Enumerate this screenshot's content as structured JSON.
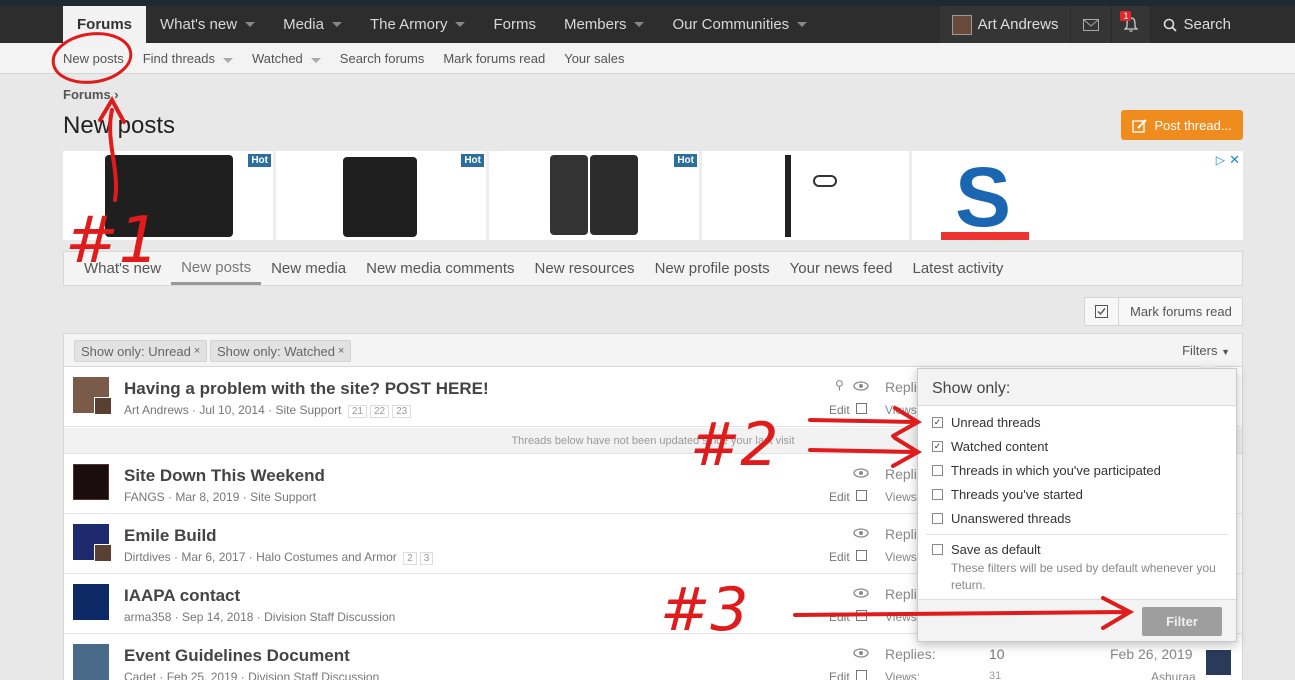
{
  "nav": {
    "items": [
      {
        "label": "Forums",
        "active": true,
        "caret": false
      },
      {
        "label": "What's new",
        "active": false,
        "caret": true
      },
      {
        "label": "Media",
        "active": false,
        "caret": true
      },
      {
        "label": "The Armory",
        "active": false,
        "caret": true
      },
      {
        "label": "Forms",
        "active": false,
        "caret": false
      },
      {
        "label": "Members",
        "active": false,
        "caret": true
      },
      {
        "label": "Our Communities",
        "active": false,
        "caret": true
      }
    ],
    "user_name": "Art Andrews",
    "alerts_count": "1",
    "search_label": "Search"
  },
  "subnav": {
    "new_posts": "New posts",
    "find_threads": "Find threads",
    "watched": "Watched",
    "search_forums": "Search forums",
    "mark_forums_read": "Mark forums read",
    "your_sales": "Your sales"
  },
  "breadcrumb": "Forums",
  "page_title": "New posts",
  "post_thread_label": "Post thread...",
  "ads": {
    "hot_label": "Hot",
    "brand_letter": "S"
  },
  "tabs": [
    {
      "label": "What's new",
      "active": false
    },
    {
      "label": "New posts",
      "active": true
    },
    {
      "label": "New media",
      "active": false
    },
    {
      "label": "New media comments",
      "active": false
    },
    {
      "label": "New resources",
      "active": false
    },
    {
      "label": "New profile posts",
      "active": false
    },
    {
      "label": "Your news feed",
      "active": false
    },
    {
      "label": "Latest activity",
      "active": false
    }
  ],
  "mark_read_label": "Mark forums read",
  "filter_pills": [
    "Show only: Unread",
    "Show only: Watched"
  ],
  "filters_label": "Filters",
  "divider_text": "Threads below have not been updated since your last visit",
  "threads": [
    {
      "title": "Having a problem with the site? POST HERE!",
      "author": "Art Andrews",
      "date": "Jul 10, 2014",
      "forum": "Site Support",
      "pages": [
        "21",
        "22",
        "23"
      ],
      "replies_label": "Replies:",
      "views_label": "Views:",
      "replies": "",
      "views": "",
      "last_date": "",
      "last_user": "",
      "sticky": true
    },
    {
      "title": "Site Down This Weekend",
      "author": "FANGS",
      "date": "Mar 8, 2019",
      "forum": "Site Support",
      "pages": [],
      "replies_label": "Replies:",
      "views_label": "Views:",
      "replies": "",
      "views": "",
      "last_date": "",
      "last_user": "",
      "sticky": false
    },
    {
      "title": "Emile Build",
      "author": "Dirtdives",
      "date": "Mar 6, 2017",
      "forum": "Halo Costumes and Armor",
      "pages": [
        "2",
        "3"
      ],
      "replies_label": "Replies:",
      "views_label": "Views:",
      "replies": "",
      "views": "",
      "last_date": "",
      "last_user": "",
      "sticky": false
    },
    {
      "title": "IAAPA contact",
      "author": "arma358",
      "date": "Sep 14, 2018",
      "forum": "Division Staff Discussion",
      "pages": [],
      "replies_label": "Replies:",
      "views_label": "Views:",
      "replies": "",
      "views": "",
      "last_date": "",
      "last_user": "",
      "sticky": false
    },
    {
      "title": "Event Guidelines Document",
      "author": "Cadet",
      "date": "Feb 25, 2019",
      "forum": "Division Staff Discussion",
      "pages": [],
      "replies_label": "Replies:",
      "views_label": "Views:",
      "replies": "10",
      "views": "31",
      "last_date": "Feb 26, 2019",
      "last_user": "Ashuraa",
      "sticky": false
    }
  ],
  "edit_label": "Edit",
  "popup": {
    "title": "Show only:",
    "options": [
      {
        "label": "Unread threads",
        "checked": true
      },
      {
        "label": "Watched content",
        "checked": true
      },
      {
        "label": "Threads in which you've participated",
        "checked": false
      },
      {
        "label": "Threads you've started",
        "checked": false
      },
      {
        "label": "Unanswered threads",
        "checked": false
      }
    ],
    "save_default": "Save as default",
    "hint": "These filters will be used by default whenever you return.",
    "filter_button": "Filter"
  },
  "annotations": {
    "label_1": "#1",
    "label_2": "#2",
    "label_3": "#3",
    "color": "#e01b1b"
  },
  "colors": {
    "accent_orange": "#f08c1e",
    "topbar": "#2d2d2d",
    "badge_red": "#e0282b"
  }
}
